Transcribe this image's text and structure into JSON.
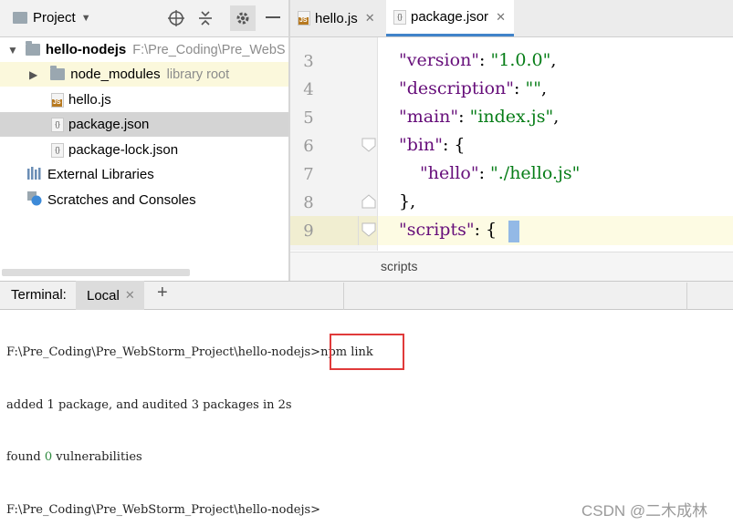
{
  "project_panel": {
    "title": "Project",
    "toolbar_icons": [
      "target-icon",
      "collapse-icon",
      "gear-icon",
      "minimize-icon"
    ],
    "tree": [
      {
        "label": "hello-nodejs",
        "hint": "F:\\Pre_Coding\\Pre_WebS"
      },
      {
        "label": "node_modules",
        "hint": "library root"
      },
      {
        "label": "hello.js"
      },
      {
        "label": "package.json"
      },
      {
        "label": "package-lock.json"
      },
      {
        "label": "External Libraries"
      },
      {
        "label": "Scratches and Consoles"
      }
    ]
  },
  "editor": {
    "tabs": [
      {
        "label": "hello.js"
      },
      {
        "label": "package.jsor"
      }
    ],
    "line_numbers": [
      "3",
      "4",
      "5",
      "6",
      "7",
      "8",
      "9"
    ],
    "lines": [
      {
        "key": "\"version\"",
        "sep": ": ",
        "value": "\"1.0.0\"",
        "end": ","
      },
      {
        "key": "\"description\"",
        "sep": ": ",
        "value": "\"\"",
        "end": ","
      },
      {
        "key": "\"main\"",
        "sep": ": ",
        "value": "\"index.js\"",
        "end": ","
      },
      {
        "key": "\"bin\"",
        "sep": ": ",
        "value": "",
        "end": "{"
      },
      {
        "key": "\"hello\"",
        "sep": ": ",
        "value": "\"./hello.js\"",
        "end": ""
      },
      {
        "key": "",
        "sep": "",
        "value": "",
        "end": "},"
      },
      {
        "key": "\"scripts\"",
        "sep": ": ",
        "value": "",
        "end": "{"
      }
    ],
    "breadcrumb": "scripts",
    "colors": {
      "key": "#660e7a",
      "string": "#067d17",
      "caret_line": "#fdfbe3"
    }
  },
  "terminal": {
    "label": "Terminal:",
    "tab": "Local",
    "add_label": "+",
    "lines": {
      "cmd_prompt": "F:\\Pre_Coding\\Pre_WebStorm_Project\\hello-nodejs>",
      "cmd": "npm link",
      "added": "added 1 package, and audited 3 packages in 2s",
      "found_pre": "found ",
      "found_num": "0",
      "found_post": " vulnerabilities",
      "prompt": "F:\\Pre_Coding\\Pre_WebStorm_Project\\hello-nodejs>"
    },
    "highlight_color": "#e03a3a"
  },
  "watermark": "CSDN @二木成林"
}
